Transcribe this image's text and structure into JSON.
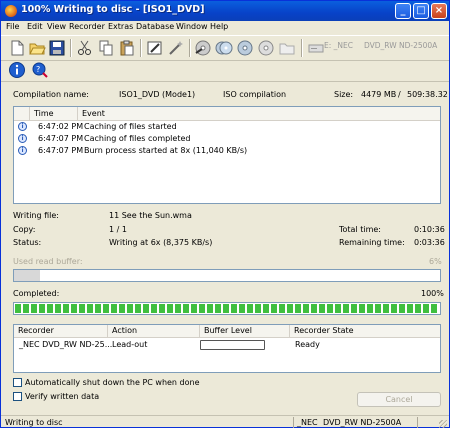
{
  "window": {
    "title": "100% Writing to disc - [ISO1_DVD]"
  },
  "menu": [
    "File",
    "Edit",
    "View",
    "Recorder",
    "Extras",
    "Database",
    "Window",
    "Help"
  ],
  "toolbar": {
    "icons": [
      "new-icon",
      "open-icon",
      "save-icon",
      "cut-icon",
      "copy-icon",
      "paste-icon",
      "properties-icon",
      "wizard-icon",
      "burn-icon",
      "copy-disc-icon",
      "erase-icon",
      "disc-info-icon",
      "folder-icon"
    ],
    "drive_prefix": "E: _NEC",
    "drive_model": "DVD_RW ND-2500A"
  },
  "info": {
    "compilation_name_label": "Compilation name:",
    "compilation_name_value": "ISO1_DVD (Mode1)",
    "compilation_type": "ISO compilation",
    "size_label": "Size:",
    "size_mb": "4479 MB",
    "size_sep": "/",
    "size_time": "509:38.32"
  },
  "log": {
    "columns": [
      "Time",
      "Event"
    ],
    "rows": [
      {
        "time": "6:47:02 PM",
        "event": "Caching of files started"
      },
      {
        "time": "6:47:07 PM",
        "event": "Caching of files completed"
      },
      {
        "time": "6:47:07 PM",
        "event": "Burn process started at 8x (11,040 KB/s)"
      }
    ]
  },
  "progress_info": {
    "writing_file_label": "Writing file:",
    "writing_file_value": "11 See the Sun.wma",
    "copy_label": "Copy:",
    "copy_value": "1 / 1",
    "status_label": "Status:",
    "status_value": "Writing at 6x (8,375 KB/s)",
    "total_time_label": "Total time:",
    "total_time_value": "0:10:36",
    "remaining_label": "Remaining time:",
    "remaining_value": "0:03:36"
  },
  "read_buffer": {
    "label": "Used read buffer:",
    "percent": "6%",
    "fraction": 0.06
  },
  "completed": {
    "label": "Completed:",
    "percent": "100%",
    "fraction": 1.0
  },
  "recorders": {
    "columns": [
      "Recorder",
      "Action",
      "Buffer Level",
      "Recorder State"
    ],
    "rows": [
      {
        "recorder": "_NEC DVD_RW ND-25...",
        "action": "Lead-out",
        "buffer_fraction": 0.0,
        "state": "Ready"
      }
    ]
  },
  "options": {
    "auto_shutdown": "Automatically shut down the PC when done",
    "verify": "Verify written data"
  },
  "buttons": {
    "cancel": "Cancel"
  },
  "statusbar": {
    "text": "Writing to disc",
    "drive_prefix": "_NEC",
    "drive_model": "DVD_RW ND-2500A"
  }
}
